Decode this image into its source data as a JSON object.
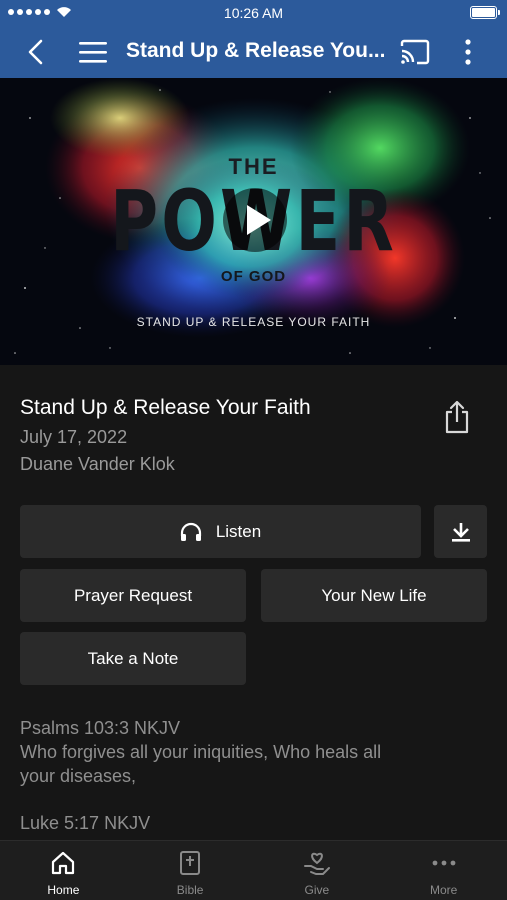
{
  "status_bar": {
    "time": "10:26 AM"
  },
  "nav": {
    "title": "Stand Up & Release You..."
  },
  "hero": {
    "art_pre": "THE",
    "art_main": "POWER",
    "art_post": "OF GOD",
    "tagline": "STAND UP & RELEASE YOUR FAITH"
  },
  "sermon": {
    "title": "Stand Up & Release Your Faith",
    "date": "July 17, 2022",
    "speaker": "Duane Vander Klok"
  },
  "actions": {
    "listen": "Listen",
    "prayer_request": "Prayer Request",
    "your_new_life": "Your New Life",
    "take_a_note": "Take a Note"
  },
  "scriptures": [
    {
      "reference": "Psalms 103:3  NKJV",
      "text": "Who forgives all your iniquities, Who heals all your diseases,"
    },
    {
      "reference": "Luke 5:17  NKJV",
      "text": ""
    }
  ],
  "tabs": [
    {
      "label": "Home",
      "icon": "home-icon",
      "active": true
    },
    {
      "label": "Bible",
      "icon": "bible-icon",
      "active": false
    },
    {
      "label": "Give",
      "icon": "give-icon",
      "active": false
    },
    {
      "label": "More",
      "icon": "more-icon",
      "active": false
    }
  ],
  "colors": {
    "nav_blue": "#2c5a9b",
    "background": "#161616",
    "button": "#2a2a2a",
    "muted_text": "#9a9a9a"
  }
}
